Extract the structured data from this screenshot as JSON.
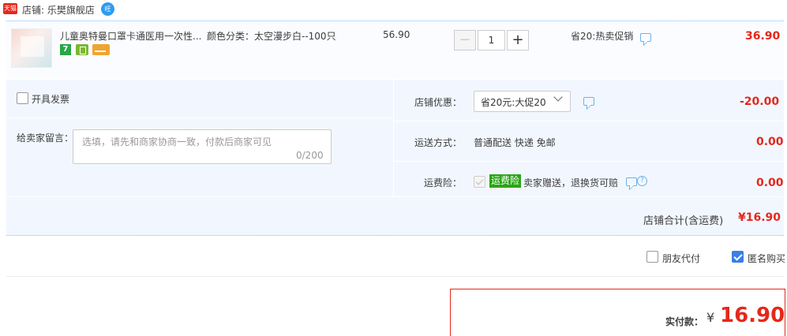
{
  "shop": {
    "logo_text": "天猫",
    "label": "店铺: 乐樊旗舰店",
    "ww_icon_text": "旺"
  },
  "item": {
    "title": "儿童奥特曼口罩卡通医用一次性...",
    "sku": "颜色分类：太空漫步白--100只",
    "badge_seven": "7",
    "unit_price": "56.90",
    "quantity": "1",
    "minus": "−",
    "plus": "+",
    "promo": "省20:热卖促销",
    "total": "36.90"
  },
  "invoice": {
    "label": "开具发票"
  },
  "message": {
    "label": "给卖家留言：",
    "placeholder": "选填，请先和商家协商一致，付款后商家可见",
    "count": "0/200"
  },
  "discount": {
    "label": "店铺优惠：",
    "selected": "省20元:大促20",
    "amount": "-20.00"
  },
  "shipping": {
    "label": "运送方式：",
    "value": "普通配送 快递 免邮",
    "amount": "0.00"
  },
  "insurance": {
    "label": "运费险：",
    "badge": "运费险",
    "desc": "卖家赠送，退换货可赔",
    "help": "?",
    "amount": "0.00"
  },
  "subtotal": {
    "label": "店铺合计(含运费)",
    "value": "¥16.90"
  },
  "options": {
    "friend_pay": "朋友代付",
    "anonymous": "匿名购买",
    "anonymous_checked": true
  },
  "payment": {
    "label": "实付款：",
    "currency": "¥",
    "amount": "16.90"
  },
  "colors": {
    "price_red": "#e4281b",
    "panel_blue": "#f2f7ff",
    "check_blue": "#3a7ee6",
    "insurance_green": "#2aa515"
  }
}
